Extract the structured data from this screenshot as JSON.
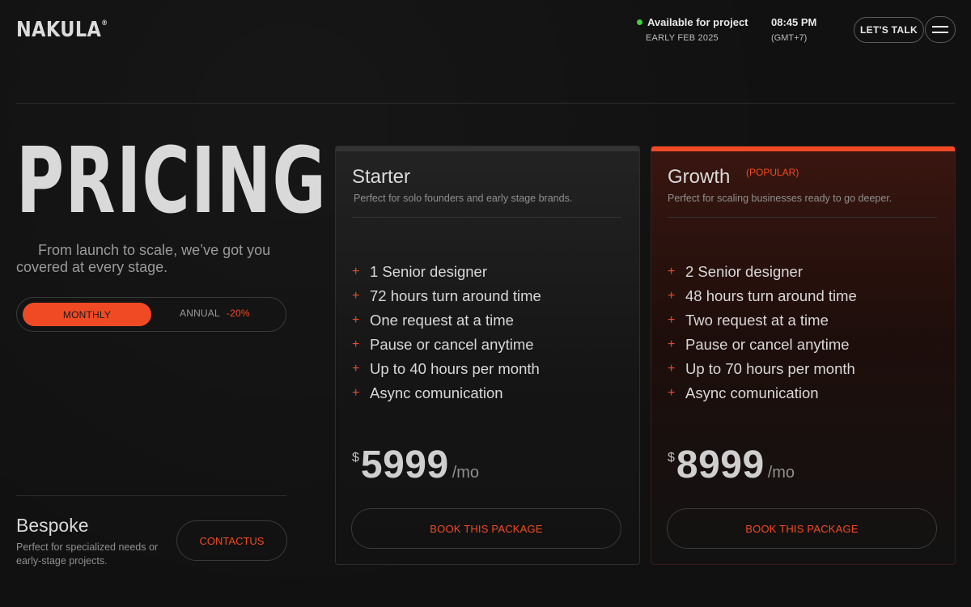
{
  "header": {
    "logo": "NAKULA",
    "logo_mark": "®",
    "availability": {
      "status": "Available for project",
      "date": "EARLY FEB 2025",
      "dot_color": "#3fd23f"
    },
    "clock": {
      "time": "08:45 PM",
      "timezone": "(GMT+7)"
    },
    "cta_label": "LET'S TALK",
    "menu_icon": "hamburger-icon"
  },
  "hero": {
    "title": "PRICING",
    "lead": "From launch to scale, we’ve got you covered at every stage."
  },
  "billing_toggle": {
    "monthly_label": "MONTHLY",
    "annual_label": "ANNUAL",
    "annual_discount": "-20%",
    "selected": "MONTHLY"
  },
  "bespoke": {
    "title": "Bespoke",
    "description": "Perfect for specialized needs or early-stage projects.",
    "button_label": "CONTACTUS"
  },
  "plans": [
    {
      "name": "Starter",
      "badge": "",
      "description": "Perfect for solo founders and early stage brands.",
      "features": [
        "1 Senior designer",
        "72 hours turn around time",
        "One request at a time",
        "Pause or cancel anytime",
        "Up to 40 hours per month",
        "Async comunication"
      ],
      "currency": "$",
      "price": "5999",
      "period": "/mo",
      "button_label": "BOOK THIS PACKAGE"
    },
    {
      "name": "Growth",
      "badge": "(POPULAR)",
      "description": "Perfect for scaling businesses ready to go deeper.",
      "features": [
        "2 Senior designer",
        "48 hours turn around time",
        "Two request at a time",
        "Pause or cancel anytime",
        "Up to 70 hours per month",
        "Async comunication"
      ],
      "currency": "$",
      "price": "8999",
      "period": "/mo",
      "button_label": "BOOK THIS PACKAGE"
    }
  ],
  "colors": {
    "accent": "#f04a24",
    "background": "#111111",
    "text": "#d8d8d8"
  }
}
